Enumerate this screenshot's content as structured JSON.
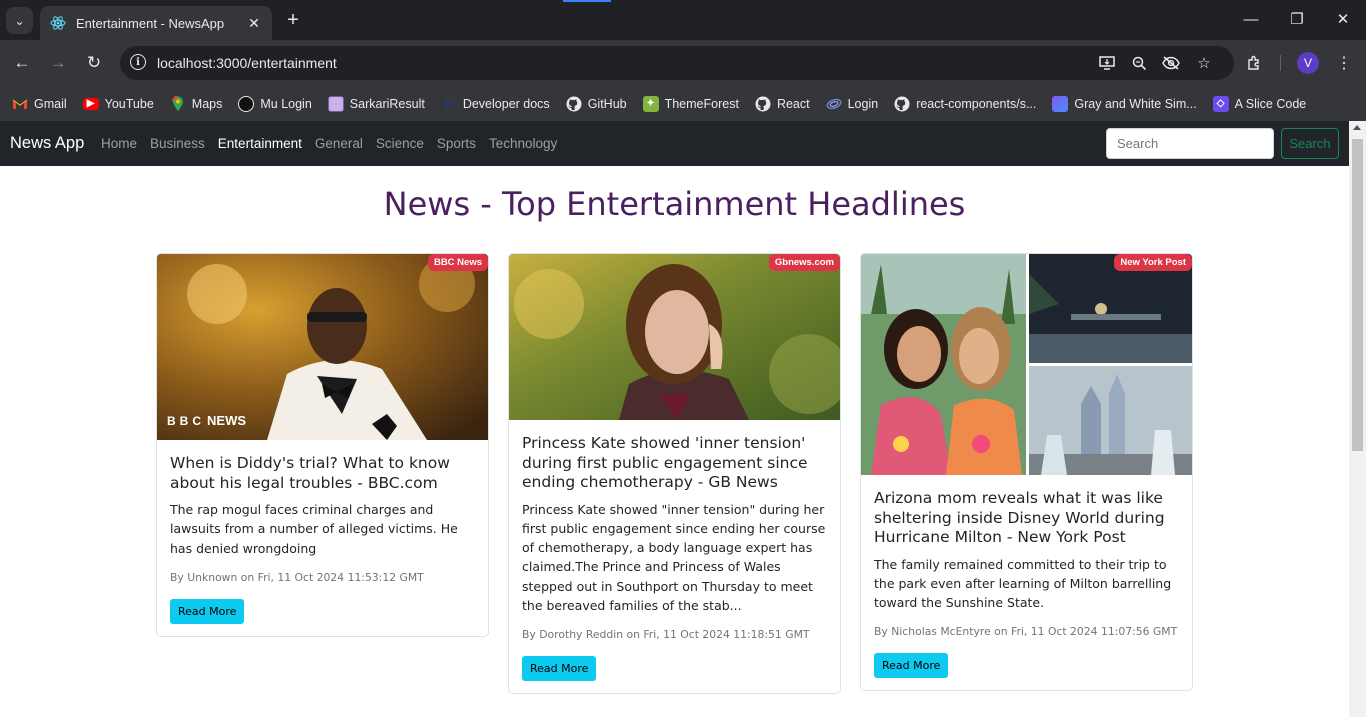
{
  "browser": {
    "tab_title": "Entertainment - NewsApp",
    "url": "localhost:3000/entertainment",
    "profile_initial": "V",
    "bookmarks": [
      {
        "label": "Gmail",
        "icon": "gmail-icon"
      },
      {
        "label": "YouTube",
        "icon": "youtube-icon"
      },
      {
        "label": "Maps",
        "icon": "maps-icon"
      },
      {
        "label": "Mu Login",
        "icon": "mu-icon"
      },
      {
        "label": "SarkariResult",
        "icon": "sarkari-icon"
      },
      {
        "label": "Developer docs",
        "icon": "paypal-icon"
      },
      {
        "label": "GitHub",
        "icon": "github-icon"
      },
      {
        "label": "ThemeForest",
        "icon": "themeforest-icon"
      },
      {
        "label": "React",
        "icon": "github-icon"
      },
      {
        "label": "Login",
        "icon": "login-icon"
      },
      {
        "label": "react-components/s...",
        "icon": "github-icon"
      },
      {
        "label": "Gray and White Sim...",
        "icon": "canva-icon"
      },
      {
        "label": "A Slice Code",
        "icon": "slice-icon"
      }
    ]
  },
  "navbar": {
    "brand": "News App",
    "links": [
      "Home",
      "Business",
      "Entertainment",
      "General",
      "Science",
      "Sports",
      "Technology"
    ],
    "active": "Entertainment",
    "search_placeholder": "Search",
    "search_button": "Search"
  },
  "heading": "News - Top Entertainment Headlines",
  "articles": [
    {
      "source": "BBC News",
      "title": "When is Diddy's trial? What to know about his legal troubles - BBC.com",
      "description": "The rap mogul faces criminal charges and lawsuits from a number of alleged victims. He has denied wrongdoing",
      "meta": "By Unknown on Fri, 11 Oct 2024 11:53:12 GMT",
      "button": "Read More",
      "image_watermark": "NEWS",
      "image_watermark_letters": [
        "B",
        "B",
        "C"
      ]
    },
    {
      "source": "Gbnews.com",
      "title": "Princess Kate showed 'inner tension' during first public engagement since ending chemotherapy - GB News",
      "description": "Princess Kate showed \"inner tension\" during her first public engagement since ending her course of chemotherapy, a body language expert has claimed.The Prince and Princess of Wales stepped out in Southport on Thursday to meet the bereaved families of the stab...",
      "meta": "By Dorothy Reddin on Fri, 11 Oct 2024 11:18:51 GMT",
      "button": "Read More"
    },
    {
      "source": "New York Post",
      "title": "Arizona mom reveals what it was like sheltering inside Disney World during Hurricane Milton - New York Post",
      "description": "The family remained committed to their trip to the park even after learning of Milton barrelling toward the Sunshine State.",
      "meta": "By Nicholas McEntyre on Fri, 11 Oct 2024 11:07:56 GMT",
      "button": "Read More"
    }
  ]
}
